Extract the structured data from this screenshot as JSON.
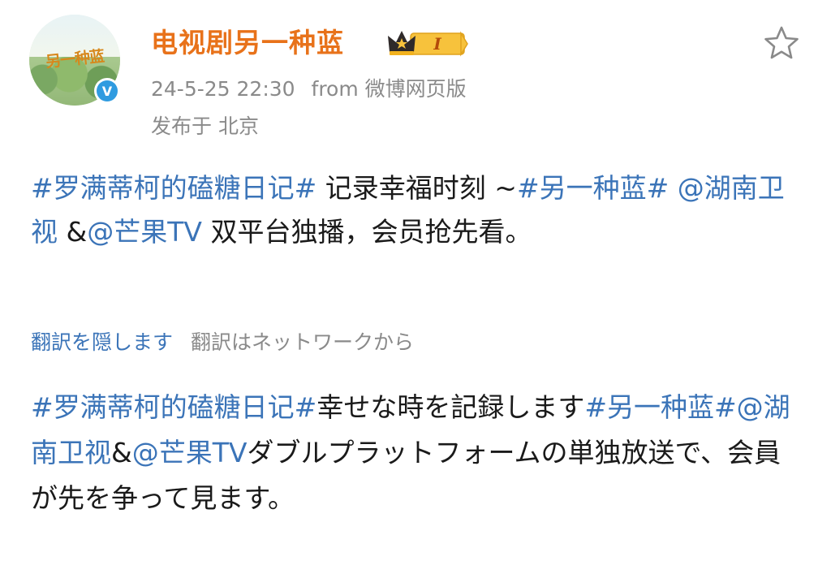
{
  "header": {
    "username": "电视剧另一种蓝",
    "avatar_text": "另一种蓝",
    "verified_mark": "V",
    "vip_level": "I",
    "timestamp": "24-5-25 22:30",
    "source": "from 微博网页版",
    "location": "发布于 北京"
  },
  "post": {
    "hashtag1": "#罗满蒂柯的磕糖日记#",
    "text1": " 记录幸福时刻 ~",
    "hashtag2": "#另一种蓝#",
    "space1": " ",
    "mention1": "@湖南卫视",
    "amp": " &",
    "mention2": "@芒果TV",
    "text2": " 双平台独播，会员抢先看。"
  },
  "translation": {
    "hide_label": "翻訳を隠します",
    "note": "翻訳はネットワークから",
    "hashtag1": "#罗满蒂柯的磕糖日记#",
    "text1": "幸せな時を記録します",
    "hashtag2": "#另一种蓝#",
    "mention1": "@湖南卫视",
    "amp": "&",
    "mention2": "@芒果TV",
    "text2": "ダブルプラットフォームの単独放送で、会員が先を争って見ます。"
  },
  "colors": {
    "username": "#e8721a",
    "link": "#3b74b8",
    "meta": "#8a8a8a",
    "verified": "#2f9be0"
  },
  "icons": {
    "star": "star-outline-icon",
    "verified": "verified-icon",
    "vip": "crown-icon"
  }
}
